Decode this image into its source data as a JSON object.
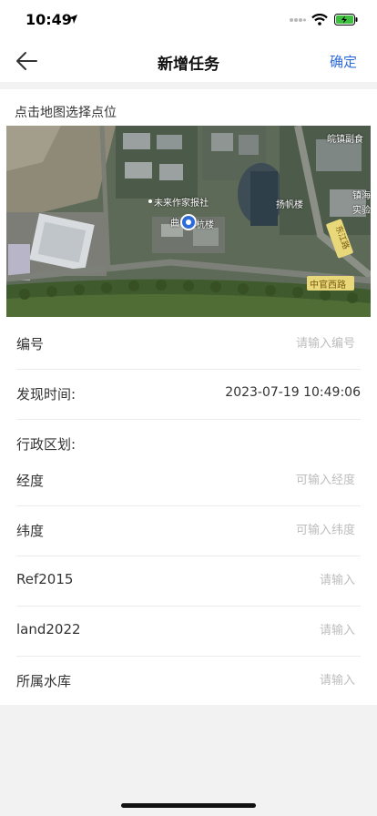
{
  "status_bar": {
    "time": "10:49",
    "icons": [
      "location-arrow-icon",
      "signal-icon",
      "wifi-icon",
      "battery-charging-icon"
    ],
    "battery_color": "#3fbf3f"
  },
  "nav": {
    "back_icon": "arrow-left-icon",
    "title": "新增任务",
    "confirm_label": "确定",
    "accent_color": "#2f6bd8"
  },
  "map": {
    "hint": "点击地图选择点位",
    "labels": {
      "publisher": "未来作家报社",
      "building_left": "曲",
      "building_main": "杭楼",
      "yangfan": "扬帆楼",
      "top_right": "皖镇副食",
      "right_mid1": "镇海",
      "right_mid2": "实验",
      "road_east": "东江路",
      "road_south": "中官西路"
    }
  },
  "form": {
    "fields": [
      {
        "label": "编号",
        "type": "input",
        "value": "",
        "placeholder": "请输入编号"
      },
      {
        "label": "发现时间:",
        "type": "text",
        "value": "2023-07-19 10:49:06"
      },
      {
        "label": "行政区划:",
        "type": "text",
        "value": ""
      },
      {
        "label": "经度",
        "type": "input",
        "value": "",
        "placeholder": "可输入经度"
      },
      {
        "label": "纬度",
        "type": "input",
        "value": "",
        "placeholder": "可输入纬度"
      },
      {
        "label": "Ref2015",
        "type": "input",
        "value": "",
        "placeholder": "请输入"
      },
      {
        "label": "land2022",
        "type": "input",
        "value": "",
        "placeholder": "请输入"
      },
      {
        "label": "所属水库",
        "type": "input",
        "value": "",
        "placeholder": "请输入"
      }
    ]
  }
}
